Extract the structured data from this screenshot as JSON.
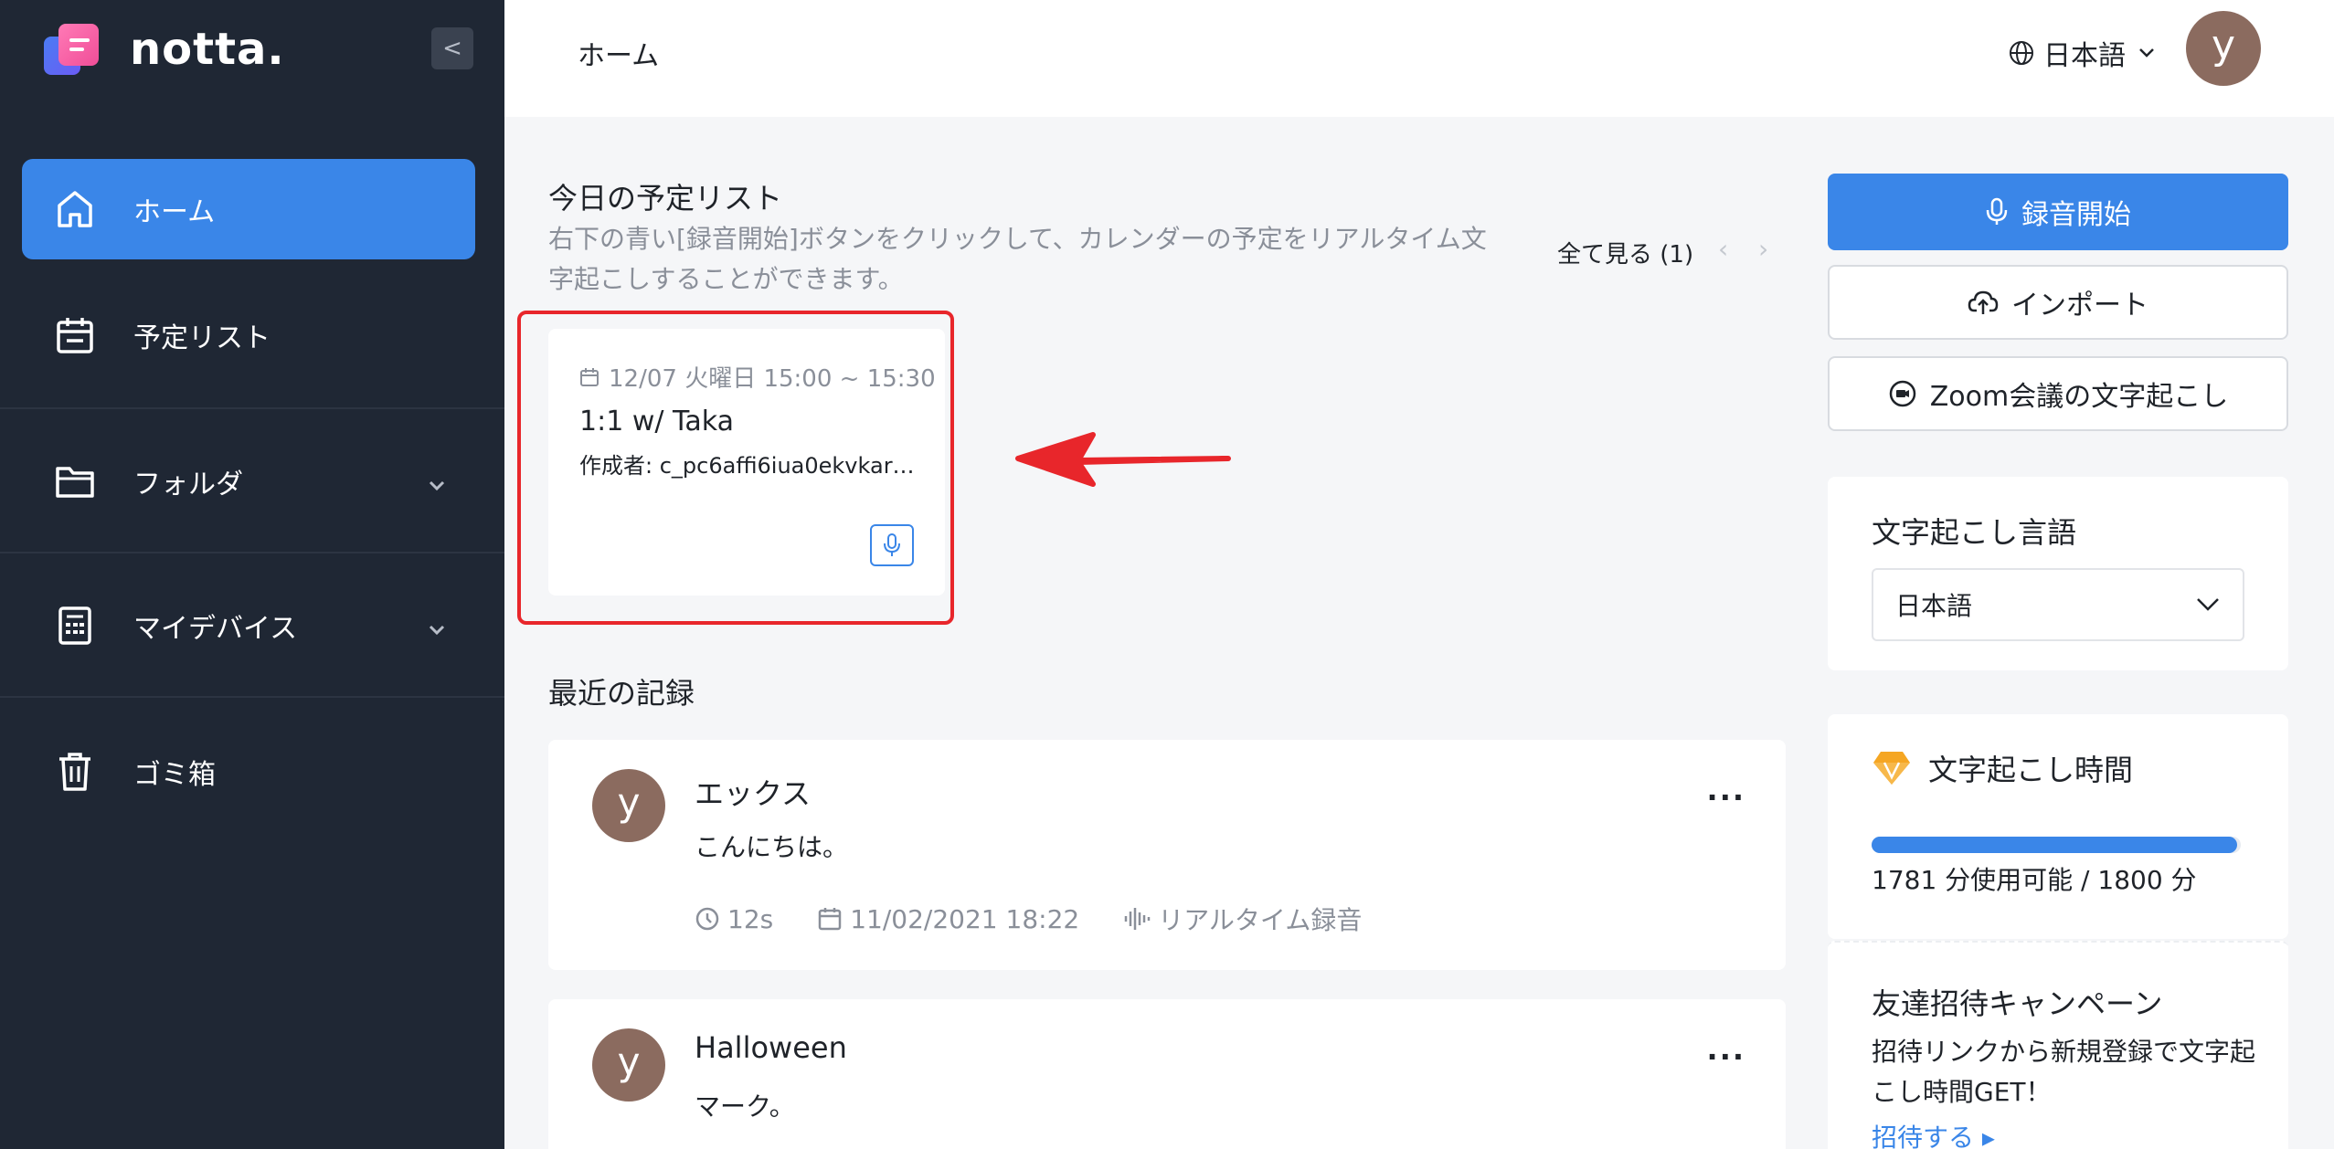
{
  "brand": {
    "name": "notta."
  },
  "sidebar": {
    "collapse_label": "<",
    "items": [
      {
        "label": "ホーム",
        "icon": "home-icon",
        "active": true
      },
      {
        "label": "予定リスト",
        "icon": "calendar-icon"
      },
      {
        "label": "フォルダ",
        "icon": "folder-icon",
        "expandable": true
      },
      {
        "label": "マイデバイス",
        "icon": "device-icon",
        "expandable": true
      },
      {
        "label": "ゴミ箱",
        "icon": "trash-icon"
      }
    ]
  },
  "header": {
    "title": "ホーム",
    "language": "日本語",
    "avatar_initial": "y"
  },
  "schedule": {
    "title": "今日の予定リスト",
    "description": "右下の青い[録音開始]ボタンをクリックして、カレンダーの予定をリアルタイム文字起こしすることができます。",
    "view_all": "全て見る (1)",
    "prev": "‹",
    "next": "›",
    "card": {
      "datetime": "12/07 火曜日 15:00 ~ 15:30",
      "title": "1:1 w/ Taka",
      "author": "作成者: c_pc6affi6iua0ekvkar…"
    }
  },
  "recent": {
    "title": "最近の記録",
    "records": [
      {
        "avatar_initial": "y",
        "title": "エックス",
        "body": "こんにちは。",
        "duration": "12s",
        "date": "11/02/2021 18:22",
        "type": "リアルタイム録音",
        "more": "···"
      },
      {
        "avatar_initial": "y",
        "title": "Halloween",
        "body": "マーク。",
        "more": "···"
      }
    ]
  },
  "actions": {
    "record": "録音開始",
    "import": "インポート",
    "zoom": "Zoom会議の文字起こし"
  },
  "transcription_language": {
    "title": "文字起こし言語",
    "value": "日本語"
  },
  "transcription_time": {
    "title": "文字起こし時間",
    "usage": "1781 分使用可能 / 1800 分",
    "progress_fraction": 0.989
  },
  "invite": {
    "title": "友達招待キャンペーン",
    "description": "招待リンクから新規登録で文字起こし時間GET！",
    "link": "招待する ▸"
  },
  "colors": {
    "sidebar_bg": "#1f2734",
    "accent": "#3a86e8",
    "avatar": "#8b6b5f",
    "highlight": "#e8262b"
  }
}
